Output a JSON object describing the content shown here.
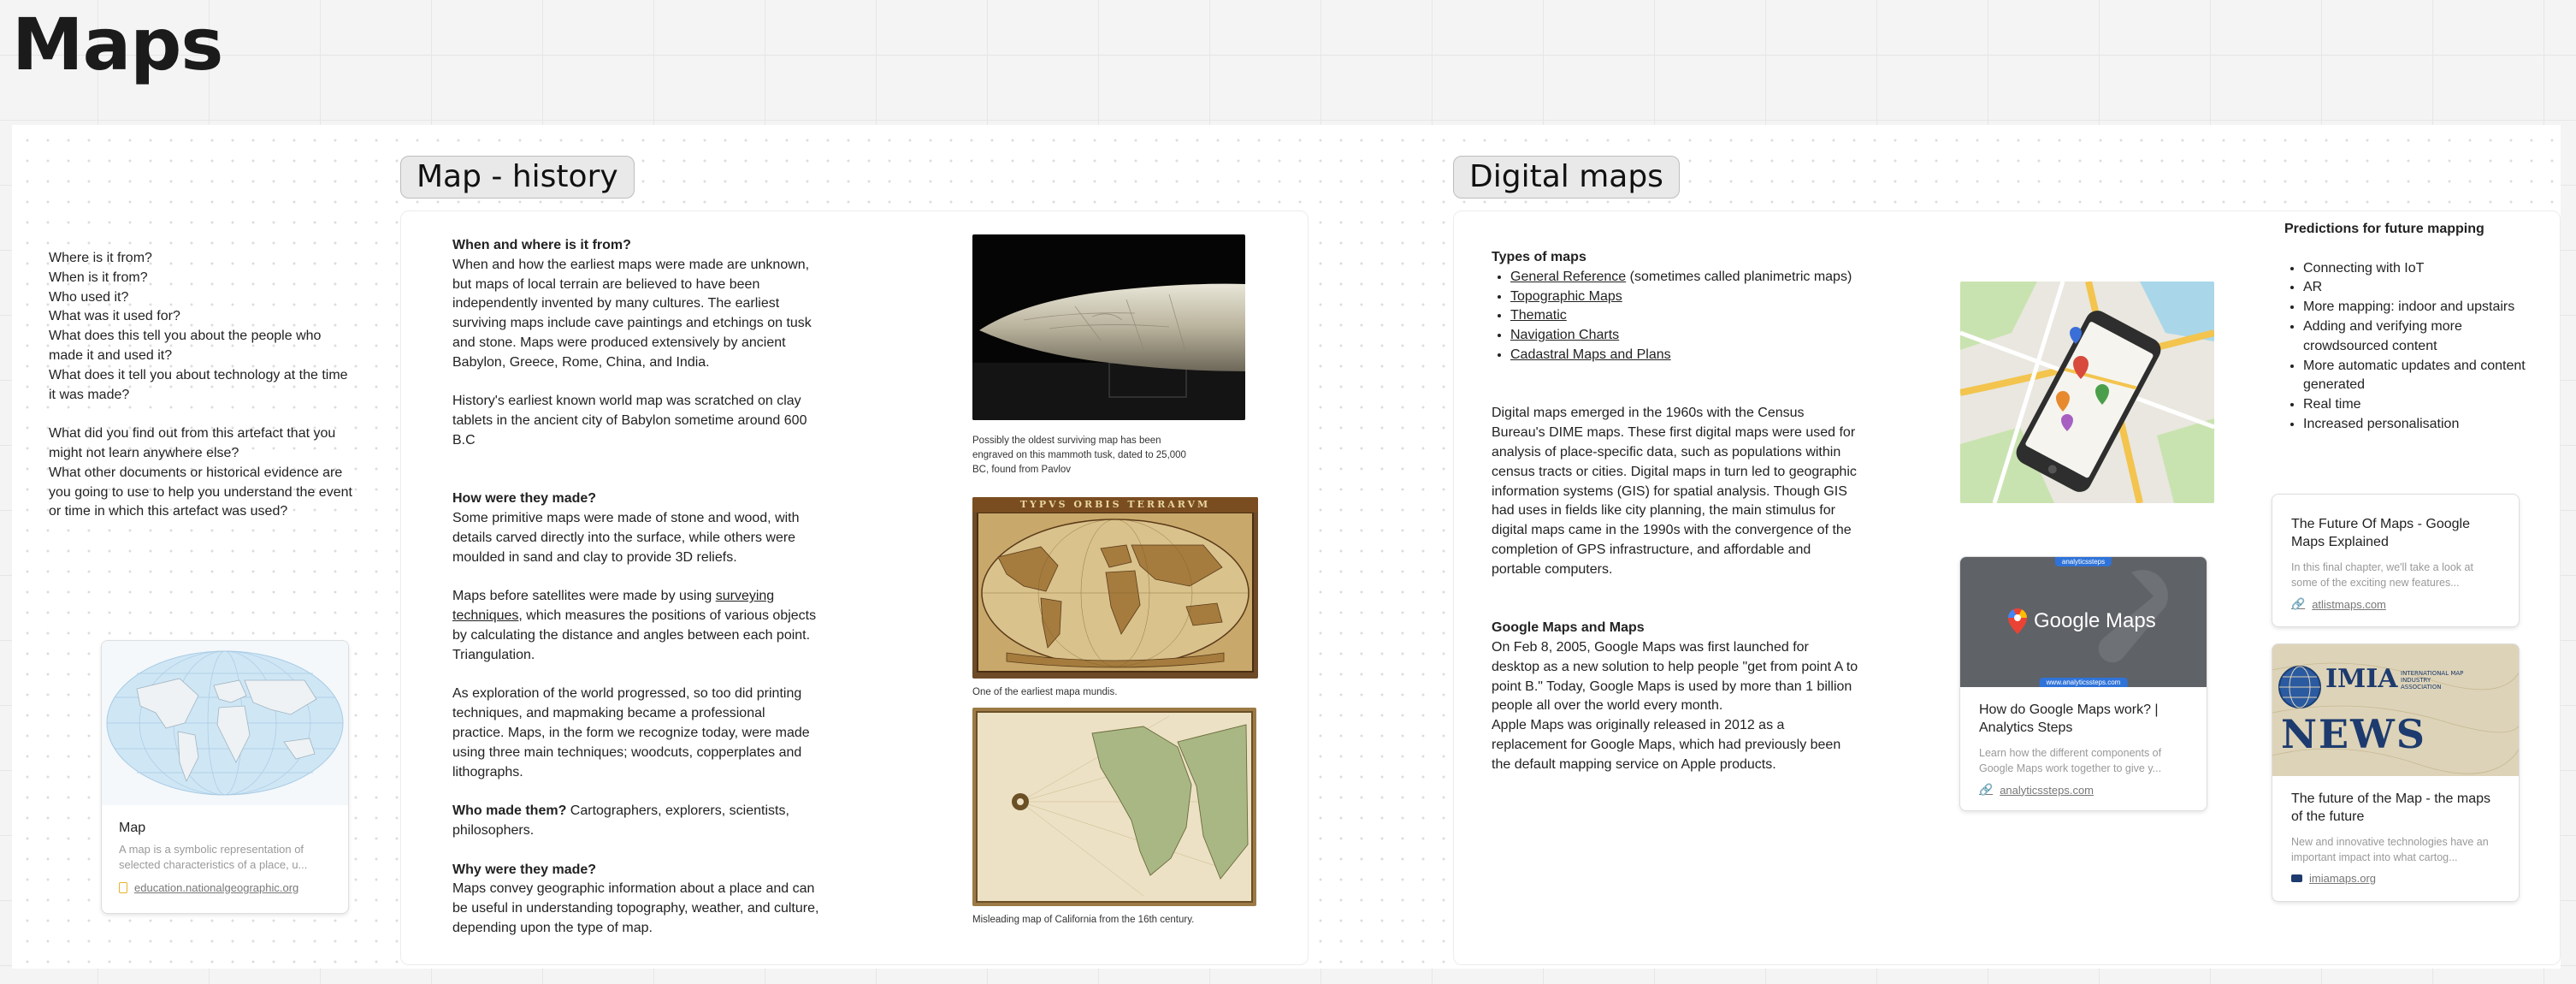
{
  "page_title": "Maps",
  "questions": [
    "Where is it from?",
    "When is it from?",
    "Who used it?",
    "What was it used for?",
    "What does this tell you about the people who made it and used it?",
    "What does it tell you about technology at the time it was made?",
    "",
    "What did you find out from this artefact that you might not learn anywhere else?",
    "What other documents or historical evidence are you going to use to help you understand the event or time in which this artefact was used?"
  ],
  "map_card": {
    "title": "Map",
    "description": "A map is a symbolic representation of selected characteristics of a place, u...",
    "link": "education.nationalgeographic.org"
  },
  "history": {
    "label": "Map - history",
    "when_heading": "When and where is it from?",
    "when_body": "When and how the earliest maps were made are unknown, but maps of local terrain are believed to have been independently invented by many cultures. The earliest surviving maps include cave paintings and etchings on tusk and stone. Maps were produced extensively by ancient Babylon, Greece, Rome, China, and India.",
    "when_body2": "History's earliest known world map was scratched on clay tablets in the ancient city of Babylon sometime around 600 B.C",
    "how_heading": "How were they made?",
    "how_body": "Some primitive maps were made of stone and wood, with details carved directly into the surface, while others were moulded in sand and clay to provide 3D reliefs.",
    "sat_pre": "Maps before satellites were made by using ",
    "sat_link": "surveying techniques",
    "sat_post": ", which measures the positions of various objects by calculating the distance and angles between each point.  Triangulation.",
    "explore_body": "As exploration of the world progressed, so too did printing techniques, and mapmaking became a professional practice. Maps, in the form we recognize today, were made using three main techniques; woodcuts, copperplates and lithographs.",
    "who_heading": "Who made them?",
    "who_body": " Cartographers, explorers, scientists, philosophers.",
    "why_heading": "Why were they made?",
    "why_body": "Maps convey geographic information about a place and can be useful in understanding topography, weather, and culture, depending upon the type of map.",
    "caption_tusk": "Possibly the oldest surviving map has been engraved on this mammoth tusk, dated to 25,000 BC, found from Pavlov",
    "world_map_banner": "TYPVS ORBIS TERRARVM",
    "caption_mundi": "One of the earliest mapa mundis.",
    "caption_california": "Misleading map of California from the 16th century."
  },
  "digital": {
    "label": "Digital maps",
    "types_heading": "Types of maps",
    "types": [
      {
        "link": "General Reference",
        "rest": " (sometimes called planimetric maps)"
      },
      {
        "link": "Topographic Maps",
        "rest": ""
      },
      {
        "link": "Thematic",
        "rest": ""
      },
      {
        "link": "Navigation Charts",
        "rest": ""
      },
      {
        "link": "Cadastral Maps and Plans",
        "rest": ""
      }
    ],
    "emerged_body": "Digital maps emerged in the 1960s with the Census Bureau's DIME maps. These first digital maps were used for analysis of place-specific data, such as populations within census tracts or cities. Digital maps in turn led to geographic information systems (GIS) for spatial analysis. Though GIS had uses in fields like city planning, the main stimulus for digital maps came in the 1990s with the convergence of the completion of GPS infrastructure, and affordable and portable computers.",
    "google_heading": "Google Maps and Maps",
    "google_body": "On Feb 8, 2005, Google Maps was first launched for desktop as a new solution to help people \"get from point A to point B.\" Today, Google Maps is used by more than 1 billion people all over the world every month.",
    "apple_body": "Apple Maps was originally released in 2012 as a replacement for Google Maps, which had previously been the default mapping service on Apple products.",
    "predictions_heading": "Predictions for future mapping",
    "predictions": [
      "Connecting with IoT",
      "AR",
      "More mapping: indoor and upstairs",
      "Adding and verifying more crowdsourced content",
      "More automatic updates and content generated",
      "Real time",
      "Increased personalisation"
    ],
    "google_card": {
      "banner_top": "analyticssteps",
      "logo_text": "Google Maps",
      "banner_bottom": "www.analyticssteps.com",
      "title": "How do Google Maps work? | Analytics Steps",
      "description": "Learn how the different components of Google Maps work together to give y...",
      "link": "analyticssteps.com"
    },
    "future_card": {
      "title": "The Future Of Maps - Google Maps Explained",
      "description": "In this final chapter, we'll take a look at some of the exciting new features...",
      "link": "atlistmaps.com"
    },
    "imia_card": {
      "logo_text": "IMIA",
      "logo_subtext": "INTERNATIONAL MAP INDUSTRY ASSOCIATION",
      "news_text": "NEWS",
      "title": "The future of the Map - the maps of the future",
      "description": "New and innovative technologies have an important impact into what cartog...",
      "link": "imiamaps.org"
    }
  },
  "colors": {
    "label_bg": "#e9e9e9",
    "link_text": "#777777",
    "card_border": "#dedede"
  }
}
